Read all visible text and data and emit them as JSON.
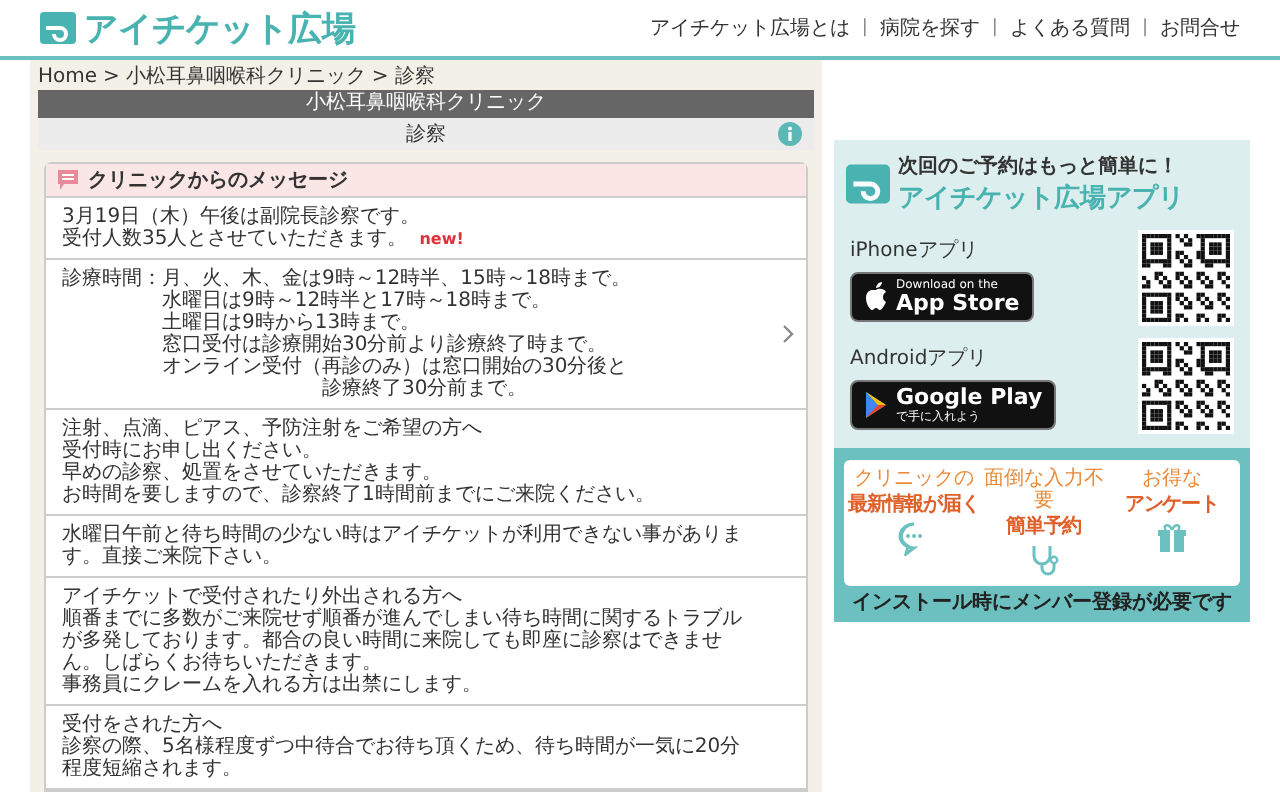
{
  "header": {
    "logo": "アイチケット広場",
    "nav": [
      "アイチケット広場とは",
      "病院を探す",
      "よくある質問",
      "お問合せ"
    ],
    "nav_separator": "|"
  },
  "breadcrumb": {
    "separator": ">",
    "items": [
      "Home",
      "小松耳鼻咽喉科クリニック",
      "診察"
    ]
  },
  "clinic_name": "小松耳鼻咽喉科クリニック",
  "page_title": "診察",
  "messages": {
    "title": "クリニックからのメッセージ",
    "items": [
      {
        "kind": "plain",
        "lines": [
          "3月19日（木）午後は副院長診察です。",
          "受付人数35人とさせていただきます。"
        ],
        "badge": "new!",
        "expandable": false
      },
      {
        "kind": "labeled",
        "label": "診療時間：",
        "lines": [
          "月、火、木、金は9時～12時半、15時～18時まで。",
          "水曜日は9時～12時半と17時～18時まで。",
          "土曜日は9時から13時まで。",
          "窓口受付は診療開始30分前より診療終了時まで。",
          "オンライン受付（再診のみ）は窓口開始の30分後と",
          "　　　　　　　　診療終了30分前まで。"
        ],
        "expandable": true
      },
      {
        "kind": "plain",
        "lines": [
          "注射、点滴、ピアス、予防注射をご希望の方へ",
          "受付時にお申し出ください。",
          "早めの診察、処置をさせていただきます。",
          "お時間を要しますので、診察終了1時間前までにご来院ください。"
        ],
        "expandable": false
      },
      {
        "kind": "plain",
        "lines": [
          "水曜日午前と待ち時間の少ない時はアイチケットが利用できない事がありま",
          "す。直接ご来院下さい。"
        ],
        "expandable": false
      },
      {
        "kind": "plain",
        "lines": [
          "アイチケットで受付されたり外出される方へ",
          "順番までに多数がご来院せず順番が進んでしまい待ち時間に関するトラブル",
          "が多発しております。都合の良い時間に来院しても即座に診察はできませ",
          "ん。しばらくお待ちいただきます。",
          "事務員にクレームを入れる方は出禁にします。"
        ],
        "expandable": false
      },
      {
        "kind": "plain",
        "lines": [
          "受付をされた方へ",
          "診察の際、5名様程度ずつ中待合でお待ち頂くため、待ち時間が一気に20分",
          "程度短縮されます。"
        ],
        "expandable": false
      }
    ]
  },
  "ad": {
    "tagline": "次回のご予約はもっと簡単に！",
    "app_name": "アイチケット広場アプリ",
    "stores": [
      {
        "kind": "ios",
        "label": "iPhoneアプリ",
        "small": "Download on the",
        "large": "App Store"
      },
      {
        "kind": "android",
        "label": "Androidアプリ",
        "small": "で手に入れよう",
        "large": "Google Play"
      }
    ],
    "features": [
      {
        "caption": "クリニックの",
        "headline": "最新情報が届く"
      },
      {
        "caption": "面倒な入力不要",
        "headline": "簡単予約"
      },
      {
        "caption": "お得な",
        "headline": "アンケート"
      }
    ],
    "note": "インストール時にメンバー登録が必要です"
  }
}
